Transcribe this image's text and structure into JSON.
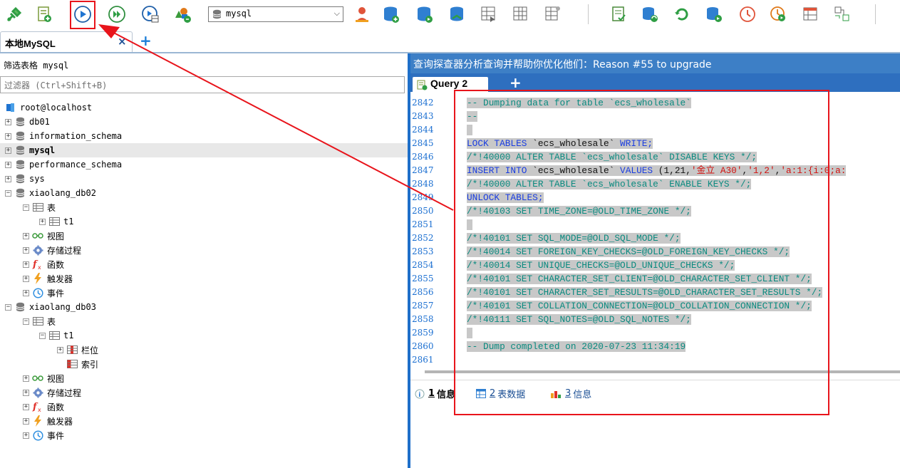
{
  "toolbar": {
    "connection_select": "mysql",
    "buttons": [
      "new-connection-icon",
      "new-query-icon",
      "run-icon",
      "run-all-icon",
      "run-selected-icon",
      "schema-icon",
      "user-icon",
      "db-add-icon",
      "db-refresh-icon",
      "db-remove-icon",
      "table-design-icon",
      "table-grid-icon",
      "table-export-icon",
      "report-icon",
      "sync-icon",
      "refresh-icon",
      "backup-icon",
      "schedule-icon",
      "execute-icon",
      "layout-icon",
      "compare-icon"
    ]
  },
  "connection_tab": {
    "label": "本地MySQL",
    "close": "×",
    "add": "+"
  },
  "left_panel": {
    "filter_label": "筛选表格 mysql",
    "filter_placeholder": "过滤器 (Ctrl+Shift+B)",
    "tree": [
      {
        "label": "root@localhost",
        "level": 0,
        "icon": "server-icon",
        "expander": "",
        "selected": false
      },
      {
        "label": "db01",
        "level": 0,
        "icon": "database-icon",
        "expander": "+",
        "selected": false
      },
      {
        "label": "information_schema",
        "level": 0,
        "icon": "database-icon",
        "expander": "+",
        "selected": false
      },
      {
        "label": "mysql",
        "level": 0,
        "icon": "database-icon",
        "expander": "+",
        "selected": true
      },
      {
        "label": "performance_schema",
        "level": 0,
        "icon": "database-icon",
        "expander": "+",
        "selected": false
      },
      {
        "label": "sys",
        "level": 0,
        "icon": "database-icon",
        "expander": "+",
        "selected": false
      },
      {
        "label": "xiaolang_db02",
        "level": 0,
        "icon": "database-icon",
        "expander": "−",
        "selected": false
      },
      {
        "label": "表",
        "level": 1,
        "icon": "table-folder-icon",
        "expander": "−",
        "selected": false
      },
      {
        "label": "t1",
        "level": 2,
        "icon": "table-icon",
        "expander": "+",
        "selected": false
      },
      {
        "label": "视图",
        "level": 1,
        "icon": "view-icon",
        "expander": "+",
        "selected": false
      },
      {
        "label": "存储过程",
        "level": 1,
        "icon": "procedure-icon",
        "expander": "+",
        "selected": false
      },
      {
        "label": "函数",
        "level": 1,
        "icon": "function-icon",
        "expander": "+",
        "selected": false
      },
      {
        "label": "触发器",
        "level": 1,
        "icon": "trigger-icon",
        "expander": "+",
        "selected": false
      },
      {
        "label": "事件",
        "level": 1,
        "icon": "event-icon",
        "expander": "+",
        "selected": false
      },
      {
        "label": "xiaolang_db03",
        "level": 0,
        "icon": "database-icon",
        "expander": "−",
        "selected": false
      },
      {
        "label": "表",
        "level": 1,
        "icon": "table-folder-icon",
        "expander": "−",
        "selected": false
      },
      {
        "label": "t1",
        "level": 2,
        "icon": "table-icon",
        "expander": "−",
        "selected": false
      },
      {
        "label": "栏位",
        "level": 3,
        "icon": "columns-icon",
        "expander": "+",
        "selected": false
      },
      {
        "label": "索引",
        "level": 3,
        "icon": "index-icon",
        "expander": "",
        "selected": false
      },
      {
        "label": "视图",
        "level": 1,
        "icon": "view-icon",
        "expander": "+",
        "selected": false
      },
      {
        "label": "存储过程",
        "level": 1,
        "icon": "procedure-icon",
        "expander": "+",
        "selected": false
      },
      {
        "label": "函数",
        "level": 1,
        "icon": "function-icon",
        "expander": "+",
        "selected": false
      },
      {
        "label": "触发器",
        "level": 1,
        "icon": "trigger-icon",
        "expander": "+",
        "selected": false
      },
      {
        "label": "事件",
        "level": 1,
        "icon": "event-icon",
        "expander": "+",
        "selected": false
      }
    ]
  },
  "right_panel": {
    "hint": "查询探查器分析查询并帮助你优化他们：Reason #55 to upgrade",
    "query_tab": "Query 2",
    "query_add": "+",
    "editor": {
      "lines": [
        {
          "no": "2842",
          "tokens": [
            [
              "cm",
              "-- Dumping data for table `ecs_wholesale`"
            ]
          ]
        },
        {
          "no": "2843",
          "tokens": [
            [
              "cm",
              "--"
            ]
          ]
        },
        {
          "no": "2844",
          "tokens": []
        },
        {
          "no": "2845",
          "tokens": [
            [
              "kw",
              "LOCK TABLES "
            ],
            [
              "pl",
              "`ecs_wholesale` "
            ],
            [
              "kw",
              "WRITE;"
            ]
          ]
        },
        {
          "no": "2846",
          "tokens": [
            [
              "cm",
              "/*!40000 ALTER TABLE `ecs_wholesale` DISABLE KEYS */;"
            ]
          ]
        },
        {
          "no": "2847",
          "tokens": [
            [
              "kw",
              "INSERT INTO "
            ],
            [
              "pl",
              "`ecs_wholesale` "
            ],
            [
              "kw",
              "VALUES "
            ],
            [
              "pl",
              "(1,21,"
            ],
            [
              "st",
              "'金立 A30'"
            ],
            [
              "pl",
              ","
            ],
            [
              "st",
              "'1,2'"
            ],
            [
              "pl",
              ","
            ],
            [
              "st",
              "'a:1:{i:0;a:"
            ]
          ]
        },
        {
          "no": "2848",
          "tokens": [
            [
              "cm",
              "/*!40000 ALTER TABLE `ecs_wholesale` ENABLE KEYS */;"
            ]
          ]
        },
        {
          "no": "2849",
          "tokens": [
            [
              "kw",
              "UNLOCK TABLES;"
            ]
          ]
        },
        {
          "no": "2850",
          "tokens": [
            [
              "cm",
              "/*!40103 SET TIME_ZONE=@OLD_TIME_ZONE */;"
            ]
          ]
        },
        {
          "no": "2851",
          "tokens": []
        },
        {
          "no": "2852",
          "tokens": [
            [
              "cm",
              "/*!40101 SET SQL_MODE=@OLD_SQL_MODE */;"
            ]
          ]
        },
        {
          "no": "2853",
          "tokens": [
            [
              "cm",
              "/*!40014 SET FOREIGN_KEY_CHECKS=@OLD_FOREIGN_KEY_CHECKS */;"
            ]
          ]
        },
        {
          "no": "2854",
          "tokens": [
            [
              "cm",
              "/*!40014 SET UNIQUE_CHECKS=@OLD_UNIQUE_CHECKS */;"
            ]
          ]
        },
        {
          "no": "2855",
          "tokens": [
            [
              "cm",
              "/*!40101 SET CHARACTER_SET_CLIENT=@OLD_CHARACTER_SET_CLIENT */;"
            ]
          ]
        },
        {
          "no": "2856",
          "tokens": [
            [
              "cm",
              "/*!40101 SET CHARACTER_SET_RESULTS=@OLD_CHARACTER_SET_RESULTS */;"
            ]
          ]
        },
        {
          "no": "2857",
          "tokens": [
            [
              "cm",
              "/*!40101 SET COLLATION_CONNECTION=@OLD_COLLATION_CONNECTION */;"
            ]
          ]
        },
        {
          "no": "2858",
          "tokens": [
            [
              "cm",
              "/*!40111 SET SQL_NOTES=@OLD_SQL_NOTES */;"
            ]
          ]
        },
        {
          "no": "2859",
          "tokens": []
        },
        {
          "no": "2860",
          "tokens": [
            [
              "cm",
              "-- Dump completed on 2020-07-23 11:34:19"
            ]
          ]
        },
        {
          "no": "2861",
          "tokens": []
        }
      ],
      "highlighted_lines": [
        "2842",
        "2843",
        "2844",
        "2845",
        "2846",
        "2847",
        "2848",
        "2849",
        "2850",
        "2851",
        "2852",
        "2853",
        "2854",
        "2855",
        "2856",
        "2857",
        "2858",
        "2859",
        "2860"
      ]
    },
    "result_tabs": [
      {
        "num": "1",
        "label": "信息",
        "icon": "info-icon",
        "active": true
      },
      {
        "num": "2",
        "label": "表数据",
        "icon": "grid-icon",
        "active": false
      },
      {
        "num": "3",
        "label": "信息",
        "icon": "chart-icon",
        "active": false
      }
    ]
  },
  "colors": {
    "comment": "#0a8a7f",
    "keyword": "#1a3de0",
    "string": "#d1120f",
    "selection": "#c8c8c8",
    "annotation": "#e8141b",
    "hint_bar": "#3d7fc6",
    "tab_strip": "#2e6fbf",
    "line_numbers": "#1b6fd1"
  }
}
